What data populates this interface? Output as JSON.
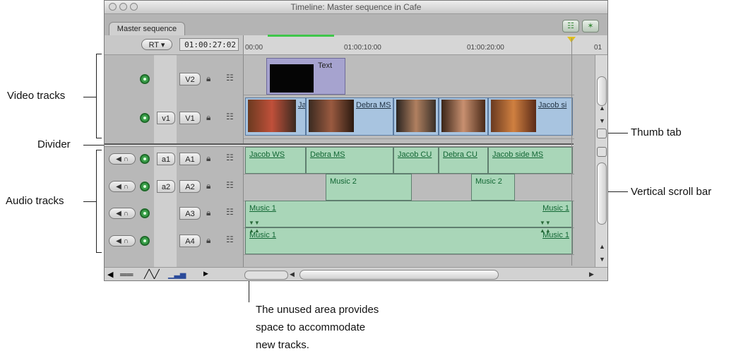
{
  "window": {
    "title": "Timeline: Master sequence in Cafe"
  },
  "tab": {
    "label": "Master sequence"
  },
  "controls": {
    "rt_label": "RT",
    "timecode": "01:00:27:02"
  },
  "ruler": {
    "labels": [
      "00:00",
      "01:00:10:00",
      "01:00:20:00",
      "01"
    ]
  },
  "video_tracks": [
    {
      "source": "",
      "dest": "V2"
    },
    {
      "source": "v1",
      "dest": "V1"
    }
  ],
  "audio_tracks": [
    {
      "source": "a1",
      "dest": "A1"
    },
    {
      "source": "a2",
      "dest": "A2"
    },
    {
      "source": "",
      "dest": "A3"
    },
    {
      "source": "",
      "dest": "A4"
    }
  ],
  "clips": {
    "text_clip": "Text",
    "v1": [
      "Ja",
      "Debra MS",
      "Jacob si"
    ],
    "a1": [
      "Jacob WS",
      "Debra MS",
      "Jacob CU",
      "Debra CU",
      "Jacob side MS"
    ],
    "a2": [
      "Music 2",
      "Music 2"
    ],
    "a3": [
      "Music 1",
      "Music 1"
    ],
    "a4": [
      "Music 1",
      "Music 1"
    ]
  },
  "callouts": {
    "video_tracks": "Video tracks",
    "divider": "Divider",
    "audio_tracks": "Audio tracks",
    "thumb_tab": "Thumb tab",
    "vertical_scroll_bar": "Vertical scroll bar",
    "unused_area": [
      "The unused area provides",
      "space to accommodate",
      "new tracks."
    ]
  },
  "colors": {
    "audio_clip": "#a9d6b8",
    "video_clip": "#a8c4e0",
    "playhead_marker": "#e0c020",
    "render_bar": "#3fc64a"
  }
}
